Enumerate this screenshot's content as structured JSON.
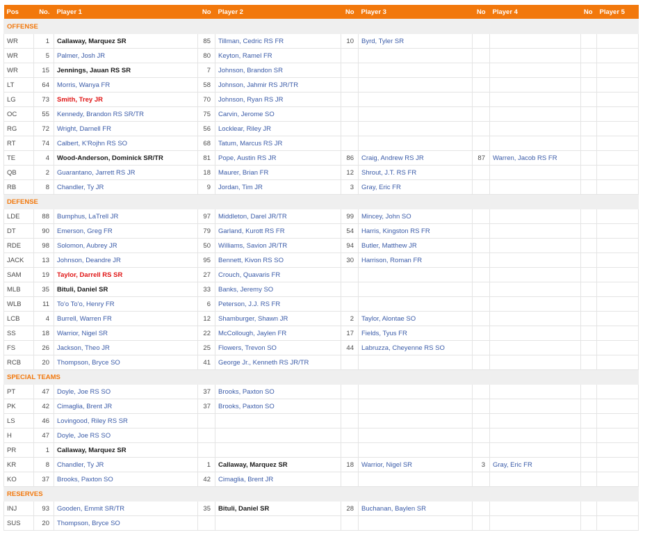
{
  "header": {
    "pos": "Pos",
    "no1": "No.",
    "player1": "Player 1",
    "no2": "No",
    "player2": "Player 2",
    "no3": "No",
    "player3": "Player 3",
    "no4": "No",
    "player4": "Player 4",
    "no5": "No",
    "player5": "Player 5"
  },
  "styles": {
    "header_bg": "#f2780c",
    "section_text": "#f2780c",
    "link_color": "#3a5ba8",
    "injured_color": "#e01515"
  },
  "sections": [
    {
      "title": "OFFENSE",
      "rows": [
        {
          "pos": "WR",
          "players": [
            {
              "no": "1",
              "name": "Callaway, Marquez SR",
              "style": "bold"
            },
            {
              "no": "85",
              "name": "Tillman, Cedric RS FR",
              "style": "link"
            },
            {
              "no": "10",
              "name": "Byrd, Tyler SR",
              "style": "link"
            }
          ]
        },
        {
          "pos": "WR",
          "players": [
            {
              "no": "5",
              "name": "Palmer, Josh JR",
              "style": "link"
            },
            {
              "no": "80",
              "name": "Keyton, Ramel FR",
              "style": "link"
            }
          ]
        },
        {
          "pos": "WR",
          "players": [
            {
              "no": "15",
              "name": "Jennings, Jauan RS SR",
              "style": "bold"
            },
            {
              "no": "7",
              "name": "Johnson, Brandon SR",
              "style": "link"
            }
          ]
        },
        {
          "pos": "LT",
          "players": [
            {
              "no": "64",
              "name": "Morris, Wanya FR",
              "style": "link"
            },
            {
              "no": "58",
              "name": "Johnson, Jahmir RS JR/TR",
              "style": "link"
            }
          ]
        },
        {
          "pos": "LG",
          "players": [
            {
              "no": "73",
              "name": "Smith, Trey JR",
              "style": "red"
            },
            {
              "no": "70",
              "name": "Johnson, Ryan RS JR",
              "style": "link"
            }
          ]
        },
        {
          "pos": "OC",
          "players": [
            {
              "no": "55",
              "name": "Kennedy, Brandon RS SR/TR",
              "style": "link"
            },
            {
              "no": "75",
              "name": "Carvin, Jerome SO",
              "style": "link"
            }
          ]
        },
        {
          "pos": "RG",
          "players": [
            {
              "no": "72",
              "name": "Wright, Darnell FR",
              "style": "link"
            },
            {
              "no": "56",
              "name": "Locklear, Riley JR",
              "style": "link"
            }
          ]
        },
        {
          "pos": "RT",
          "players": [
            {
              "no": "74",
              "name": "Calbert, K'Rojhn RS SO",
              "style": "link"
            },
            {
              "no": "68",
              "name": "Tatum, Marcus RS JR",
              "style": "link"
            }
          ]
        },
        {
          "pos": "TE",
          "players": [
            {
              "no": "4",
              "name": "Wood-Anderson, Dominick SR/TR",
              "style": "bold"
            },
            {
              "no": "81",
              "name": "Pope, Austin RS JR",
              "style": "link"
            },
            {
              "no": "86",
              "name": "Craig, Andrew RS JR",
              "style": "link"
            },
            {
              "no": "87",
              "name": "Warren, Jacob RS FR",
              "style": "link"
            }
          ]
        },
        {
          "pos": "QB",
          "players": [
            {
              "no": "2",
              "name": "Guarantano, Jarrett RS JR",
              "style": "link"
            },
            {
              "no": "18",
              "name": "Maurer, Brian FR",
              "style": "link"
            },
            {
              "no": "12",
              "name": "Shrout, J.T. RS FR",
              "style": "link"
            }
          ]
        },
        {
          "pos": "RB",
          "players": [
            {
              "no": "8",
              "name": "Chandler, Ty JR",
              "style": "link"
            },
            {
              "no": "9",
              "name": "Jordan, Tim JR",
              "style": "link"
            },
            {
              "no": "3",
              "name": "Gray, Eric FR",
              "style": "link"
            }
          ]
        }
      ]
    },
    {
      "title": "DEFENSE",
      "rows": [
        {
          "pos": "LDE",
          "players": [
            {
              "no": "88",
              "name": "Bumphus, LaTrell JR",
              "style": "link"
            },
            {
              "no": "97",
              "name": "Middleton, Darel JR/TR",
              "style": "link"
            },
            {
              "no": "99",
              "name": "Mincey, John SO",
              "style": "link"
            }
          ]
        },
        {
          "pos": "DT",
          "players": [
            {
              "no": "90",
              "name": "Emerson, Greg FR",
              "style": "link"
            },
            {
              "no": "79",
              "name": "Garland, Kurott RS FR",
              "style": "link"
            },
            {
              "no": "54",
              "name": "Harris, Kingston RS FR",
              "style": "link"
            }
          ]
        },
        {
          "pos": "RDE",
          "players": [
            {
              "no": "98",
              "name": "Solomon, Aubrey JR",
              "style": "link"
            },
            {
              "no": "50",
              "name": "Williams, Savion JR/TR",
              "style": "link"
            },
            {
              "no": "94",
              "name": "Butler, Matthew JR",
              "style": "link"
            }
          ]
        },
        {
          "pos": "JACK",
          "players": [
            {
              "no": "13",
              "name": "Johnson, Deandre JR",
              "style": "link"
            },
            {
              "no": "95",
              "name": "Bennett, Kivon RS SO",
              "style": "link"
            },
            {
              "no": "30",
              "name": "Harrison, Roman FR",
              "style": "link"
            }
          ]
        },
        {
          "pos": "SAM",
          "players": [
            {
              "no": "19",
              "name": "Taylor, Darrell RS SR",
              "style": "red"
            },
            {
              "no": "27",
              "name": "Crouch, Quavaris FR",
              "style": "link"
            }
          ]
        },
        {
          "pos": "MLB",
          "players": [
            {
              "no": "35",
              "name": "Bituli, Daniel SR",
              "style": "bold"
            },
            {
              "no": "33",
              "name": "Banks, Jeremy SO",
              "style": "link"
            }
          ]
        },
        {
          "pos": "WLB",
          "players": [
            {
              "no": "11",
              "name": "To'o To'o, Henry FR",
              "style": "link"
            },
            {
              "no": "6",
              "name": "Peterson, J.J. RS FR",
              "style": "link"
            }
          ]
        },
        {
          "pos": "LCB",
          "players": [
            {
              "no": "4",
              "name": "Burrell, Warren FR",
              "style": "link"
            },
            {
              "no": "12",
              "name": "Shamburger, Shawn JR",
              "style": "link"
            },
            {
              "no": "2",
              "name": "Taylor, Alontae SO",
              "style": "link"
            }
          ]
        },
        {
          "pos": "SS",
          "players": [
            {
              "no": "18",
              "name": "Warrior, Nigel SR",
              "style": "link"
            },
            {
              "no": "22",
              "name": "McCollough, Jaylen FR",
              "style": "link"
            },
            {
              "no": "17",
              "name": "Fields, Tyus FR",
              "style": "link"
            }
          ]
        },
        {
          "pos": "FS",
          "players": [
            {
              "no": "26",
              "name": "Jackson, Theo JR",
              "style": "link"
            },
            {
              "no": "25",
              "name": "Flowers, Trevon SO",
              "style": "link"
            },
            {
              "no": "44",
              "name": "Labruzza, Cheyenne RS SO",
              "style": "link"
            }
          ]
        },
        {
          "pos": "RCB",
          "players": [
            {
              "no": "20",
              "name": "Thompson, Bryce SO",
              "style": "link"
            },
            {
              "no": "41",
              "name": "George Jr., Kenneth RS JR/TR",
              "style": "link"
            }
          ]
        }
      ]
    },
    {
      "title": "SPECIAL TEAMS",
      "rows": [
        {
          "pos": "PT",
          "players": [
            {
              "no": "47",
              "name": "Doyle, Joe RS SO",
              "style": "link"
            },
            {
              "no": "37",
              "name": "Brooks, Paxton SO",
              "style": "link"
            }
          ]
        },
        {
          "pos": "PK",
          "players": [
            {
              "no": "42",
              "name": "Cimaglia, Brent JR",
              "style": "link"
            },
            {
              "no": "37",
              "name": "Brooks, Paxton SO",
              "style": "link"
            }
          ]
        },
        {
          "pos": "LS",
          "players": [
            {
              "no": "46",
              "name": "Lovingood, Riley RS SR",
              "style": "link"
            }
          ]
        },
        {
          "pos": "H",
          "players": [
            {
              "no": "47",
              "name": "Doyle, Joe RS SO",
              "style": "link"
            }
          ]
        },
        {
          "pos": "PR",
          "players": [
            {
              "no": "1",
              "name": "Callaway, Marquez SR",
              "style": "bold"
            }
          ]
        },
        {
          "pos": "KR",
          "players": [
            {
              "no": "8",
              "name": "Chandler, Ty JR",
              "style": "link"
            },
            {
              "no": "1",
              "name": "Callaway, Marquez SR",
              "style": "bold"
            },
            {
              "no": "18",
              "name": "Warrior, Nigel SR",
              "style": "link"
            },
            {
              "no": "3",
              "name": "Gray, Eric FR",
              "style": "link"
            }
          ]
        },
        {
          "pos": "KO",
          "players": [
            {
              "no": "37",
              "name": "Brooks, Paxton SO",
              "style": "link"
            },
            {
              "no": "42",
              "name": "Cimaglia, Brent JR",
              "style": "link"
            }
          ]
        }
      ]
    },
    {
      "title": "RESERVES",
      "rows": [
        {
          "pos": "INJ",
          "players": [
            {
              "no": "93",
              "name": "Gooden, Emmit SR/TR",
              "style": "link"
            },
            {
              "no": "35",
              "name": "Bituli, Daniel SR",
              "style": "bold"
            },
            {
              "no": "28",
              "name": "Buchanan, Baylen SR",
              "style": "link"
            }
          ]
        },
        {
          "pos": "SUS",
          "players": [
            {
              "no": "20",
              "name": "Thompson, Bryce SO",
              "style": "link"
            }
          ]
        }
      ]
    }
  ]
}
